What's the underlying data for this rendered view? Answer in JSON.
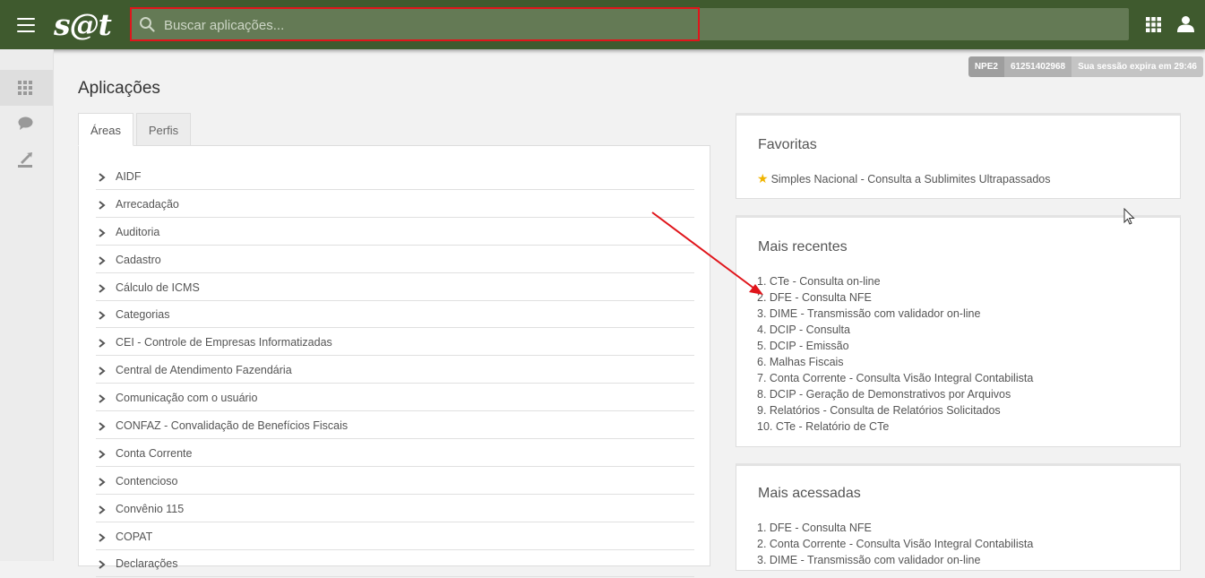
{
  "header": {
    "logo": "s@t",
    "search_placeholder": "Buscar aplicações..."
  },
  "session": {
    "environment": "NPE2",
    "user_id": "61251402968",
    "expires": "Sua sessão expira em 29:46"
  },
  "page": {
    "title": "Aplicações"
  },
  "tabs": [
    {
      "label": "Áreas",
      "active": true
    },
    {
      "label": "Perfis",
      "active": false
    }
  ],
  "areas": [
    "AIDF",
    "Arrecadação",
    "Auditoria",
    "Cadastro",
    "Cálculo de ICMS",
    "Categorias",
    "CEI - Controle de Empresas Informatizadas",
    "Central de Atendimento Fazendária",
    "Comunicação com o usuário",
    "CONFAZ - Convalidação de Benefícios Fiscais",
    "Conta Corrente",
    "Contencioso",
    "Convênio 115",
    "COPAT",
    "Declarações"
  ],
  "favoritas": {
    "title": "Favoritas",
    "items": [
      "Simples Nacional - Consulta a Sublimites Ultrapassados"
    ]
  },
  "recentes": {
    "title": "Mais recentes",
    "items": [
      "1. CTe - Consulta on-line",
      "2. DFE - Consulta NFE",
      "3. DIME - Transmissão com validador on-line",
      "4. DCIP - Consulta",
      "5. DCIP - Emissão",
      "6. Malhas Fiscais",
      "7. Conta Corrente - Consulta Visão Integral Contabilista",
      "8. DCIP - Geração de Demonstrativos por Arquivos",
      "9. Relatórios - Consulta de Relatórios Solicitados",
      "10. CTe - Relatório de CTe"
    ]
  },
  "acessadas": {
    "title": "Mais acessadas",
    "items": [
      "1. DFE - Consulta NFE",
      "2. Conta Corrente - Consulta Visão Integral Contabilista",
      "3. DIME - Transmissão com validador on-line"
    ]
  },
  "colors": {
    "topbar": "#3f5a2e",
    "search_bg": "#647a55",
    "highlight": "#e0151b",
    "star": "#f0b400"
  },
  "icons": [
    "menu-icon",
    "search-icon",
    "apps-grid-icon",
    "user-icon",
    "chat-icon",
    "export-icon",
    "chevron-right-icon",
    "star-icon"
  ]
}
